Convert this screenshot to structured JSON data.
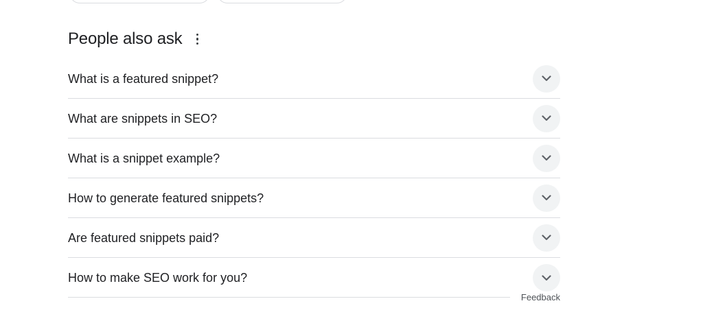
{
  "paa": {
    "title": "People also ask",
    "more_icon": "more-vert-icon",
    "expand_icon": "chevron-down-icon",
    "questions": [
      "What is a featured snippet?",
      "What are snippets in SEO?",
      "What is a snippet example?",
      "How to generate featured snippets?",
      "Are featured snippets paid?",
      "How to make SEO work for you?"
    ],
    "feedback_label": "Feedback"
  },
  "colors": {
    "text": "#202124",
    "divider": "#dadce0",
    "button_bg": "#f1f3f4",
    "icon": "#5f6368",
    "muted": "#4d5156"
  }
}
